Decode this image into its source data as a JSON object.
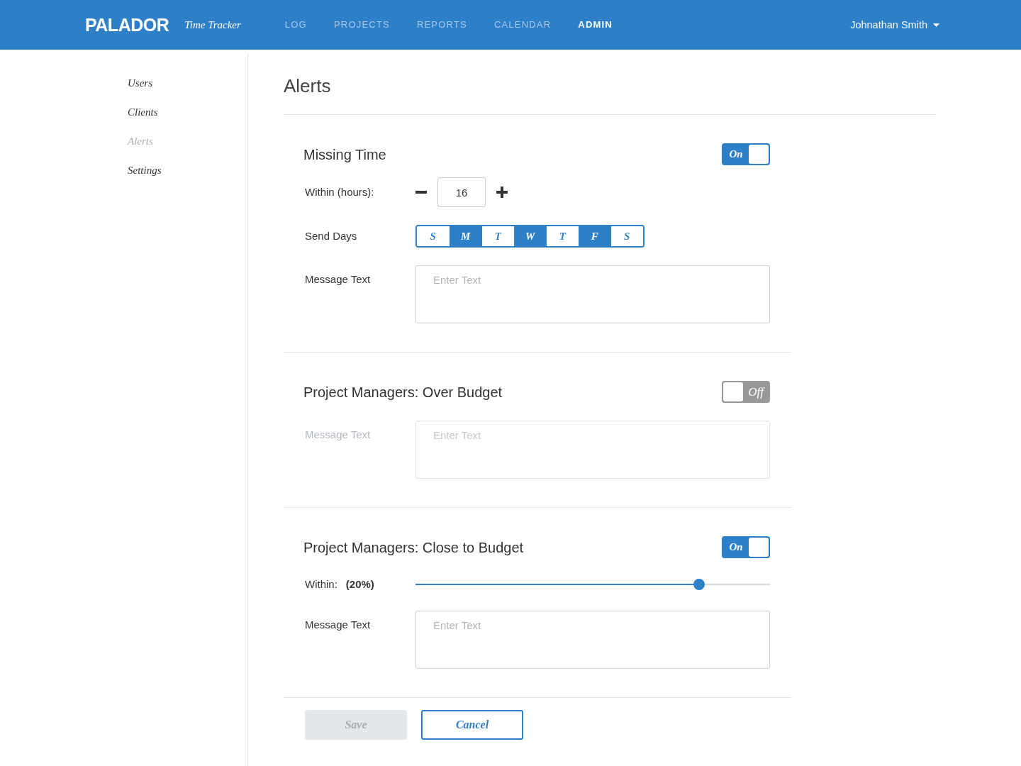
{
  "header": {
    "logo": "PALADOR",
    "app_name": "Time Tracker",
    "nav": [
      {
        "label": "LOG",
        "selected": false
      },
      {
        "label": "PROJECTS",
        "selected": false
      },
      {
        "label": "REPORTS",
        "selected": false
      },
      {
        "label": "CALENDAR",
        "selected": false
      },
      {
        "label": "ADMIN",
        "selected": true
      }
    ],
    "user": "Johnathan Smith"
  },
  "sidebar": {
    "items": [
      {
        "label": "Users",
        "selected": false
      },
      {
        "label": "Clients",
        "selected": false
      },
      {
        "label": "Alerts",
        "selected": true
      },
      {
        "label": "Settings",
        "selected": false
      }
    ]
  },
  "page_title": "Alerts",
  "alerts": [
    {
      "title": "Missing Time",
      "toggle": {
        "label": "On",
        "on": true
      },
      "rows": [
        {
          "kind": "stepper",
          "label": "Within (hours):",
          "value": "16"
        },
        {
          "kind": "days",
          "label": "Send Days",
          "days": [
            {
              "label": "S",
              "selected": false
            },
            {
              "label": "M",
              "selected": true
            },
            {
              "label": "T",
              "selected": false
            },
            {
              "label": "W",
              "selected": true
            },
            {
              "label": "T",
              "selected": false
            },
            {
              "label": "F",
              "selected": true
            },
            {
              "label": "S",
              "selected": false
            }
          ]
        },
        {
          "kind": "message",
          "label": "Message Text",
          "placeholder": "Enter Text"
        }
      ]
    },
    {
      "title": "Project Managers: Over Budget",
      "toggle": {
        "label": "Off",
        "on": false
      },
      "rows": [
        {
          "kind": "message",
          "label": "Message Text",
          "placeholder": "Enter Text"
        }
      ]
    },
    {
      "title": "Project Managers: Close to Budget",
      "toggle": {
        "label": "On",
        "on": true
      },
      "rows": [
        {
          "kind": "slider",
          "label": "Within:",
          "reading": "(20%)",
          "level": 0.8
        },
        {
          "kind": "message",
          "label": "Message Text",
          "placeholder": "Enter Text"
        }
      ]
    }
  ],
  "buttons": [
    {
      "label": "Save",
      "disabled": true
    },
    {
      "label": "Cancel",
      "disabled": false
    }
  ]
}
